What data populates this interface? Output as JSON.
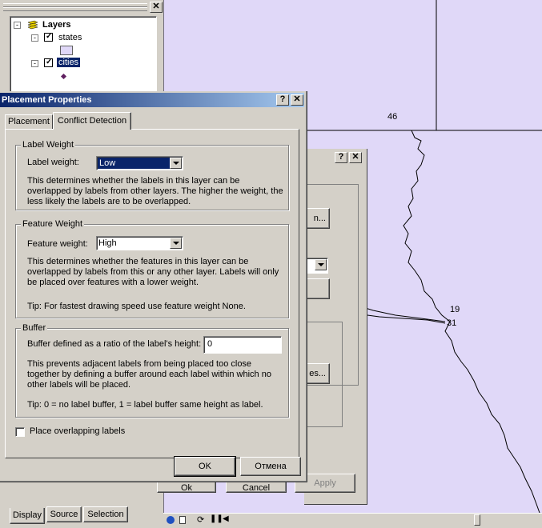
{
  "toc": {
    "layers_label": "Layers",
    "states_label": "states",
    "cities_label": "cities",
    "tabs": [
      "Display",
      "Source",
      "Selection"
    ]
  },
  "map": {
    "labels": [
      "46",
      "19",
      "31"
    ],
    "fill_color": "#e0d8f8"
  },
  "back_dialog": {
    "button_partial_1": "n...",
    "button_partial_2": "es...",
    "ok": "Ok",
    "cancel": "Cancel",
    "apply": "Apply"
  },
  "dialog": {
    "title": "Placement Properties",
    "help_btn": "?",
    "close_btn": "✕",
    "tabs": [
      "Placement",
      "Conflict Detection"
    ],
    "label_weight": {
      "group": "Label Weight",
      "field_label": "Label weight:",
      "value": "Low",
      "description": "This determines whether the labels in this layer can be overlapped by labels from other layers.  The higher the weight, the less likely the labels are to be overlapped."
    },
    "feature_weight": {
      "group": "Feature Weight",
      "field_label": "Feature weight:",
      "value": "High",
      "description": "This determines whether the features in this layer can be overlapped by labels from this or any other layer.  Labels will only be placed over features with a lower weight.",
      "tip": "Tip:  For fastest drawing speed use feature weight None."
    },
    "buffer": {
      "group": "Buffer",
      "field_label": "Buffer defined as a ratio of the label's height:",
      "value": "0",
      "description": "This prevents adjacent labels from being placed too close together by defining a buffer around each label within which no other labels will be placed.",
      "tip": "Tip:  0 = no label buffer, 1 = label buffer same height as label."
    },
    "overlap_checkbox": "Place overlapping labels",
    "ok": "OK",
    "cancel": "Отмена"
  }
}
